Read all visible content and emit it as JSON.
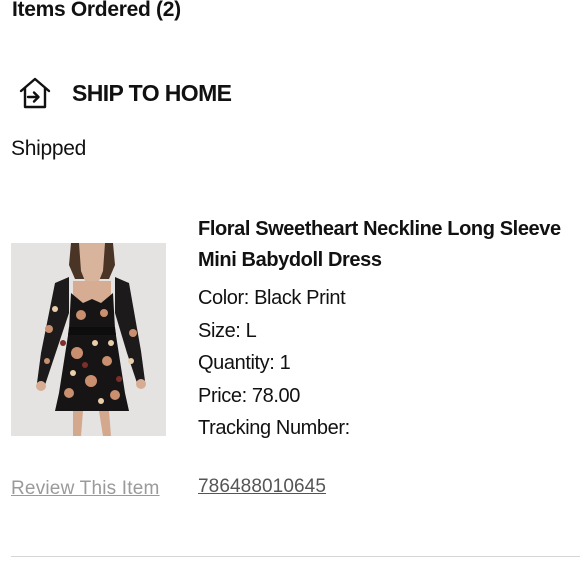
{
  "order": {
    "items_title": "Items Ordered (2)"
  },
  "shipping": {
    "icon": "ship-to-home-icon",
    "label": "SHIP TO HOME",
    "status": "Shipped"
  },
  "item": {
    "image_alt": "Model wearing a black floral print long sleeve mini babydoll dress",
    "name": "Floral Sweetheart Neckline Long Sleeve Mini Babydoll Dress",
    "color_line": "Color: Black Print",
    "size_line": "Size: L",
    "quantity_line": "Quantity: 1",
    "price_line": "Price: 78.00",
    "tracking_label": "Tracking Number:",
    "tracking_number": "786488010645",
    "review_link": "Review This Item"
  },
  "colors": {
    "text": "#111111",
    "review_link": "#9a9a9a",
    "tracking_link": "#555555",
    "divider": "#d6d6d6",
    "image_background": "#e4e3e1"
  }
}
